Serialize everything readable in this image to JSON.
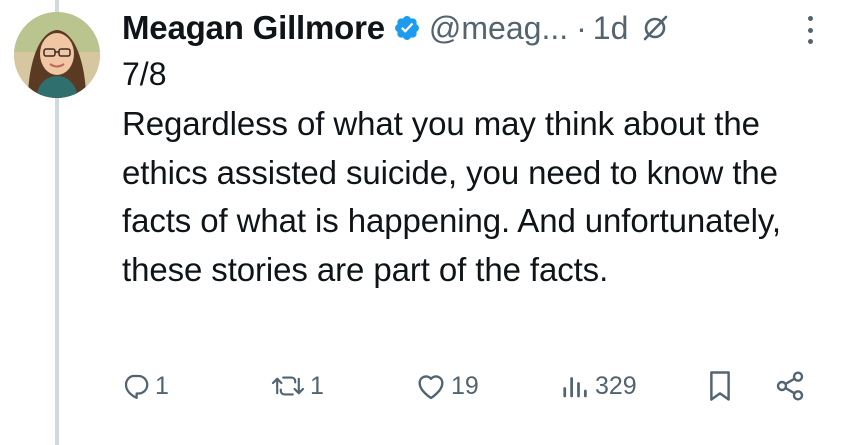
{
  "tweet": {
    "author": {
      "display_name": "Meagan Gillmore",
      "handle": "@meag...",
      "verified": true
    },
    "time_separator": "·",
    "timestamp": "1d",
    "thread_index": "7/8",
    "text": "Regardless of what you may think about the ethics assisted suicide, you need to know the facts of what is happening. And unfortunately, these stories are part of the facts.",
    "metrics": {
      "replies": "1",
      "retweets": "1",
      "likes": "19",
      "views": "329"
    }
  },
  "colors": {
    "text": "#0f1419",
    "secondary": "#536471",
    "verified_badge": "#1d9bf0",
    "thread_line": "#cfd9de"
  },
  "icons": {
    "verified": "verified-badge-icon",
    "edited": "edited-icon",
    "more": "more-options-icon",
    "reply": "reply-icon",
    "retweet": "retweet-icon",
    "like": "like-icon",
    "views": "views-icon",
    "bookmark": "bookmark-icon",
    "share": "share-icon"
  }
}
